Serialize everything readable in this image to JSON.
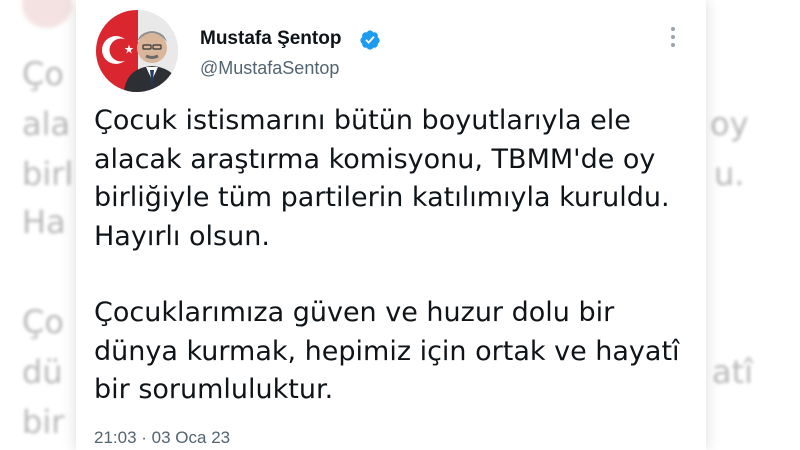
{
  "tweet": {
    "author_name": "Mustafa Şentop",
    "handle": "@MustafaSentop",
    "paragraphs": [
      "Çocuk istismarını bütün boyutlarıyla ele\nalacak araştırma komisyonu, TBMM'de oy\nbirliğiyle tüm partilerin katılımıyla kuruldu.\nHayırlı olsun.",
      "Çocuklarımıza güven ve huzur dolu bir\ndünya kurmak, hepimiz için ortak ve hayatî\nbir sorumluluktur."
    ],
    "time": "21:03",
    "separator": " · ",
    "date": "03 Oca 23"
  },
  "background_text": {
    "left": [
      "Ço",
      "ala",
      "birl",
      "Ha",
      "Ço",
      "dü",
      "bir"
    ],
    "right": [
      "oy",
      "u.",
      "atî"
    ]
  },
  "colors": {
    "verified_blue": "#1d9bf0",
    "text_primary": "#0f1419",
    "text_secondary": "#536471"
  },
  "icons": {
    "verified": "verified-badge-icon",
    "more": "more-options-icon"
  }
}
